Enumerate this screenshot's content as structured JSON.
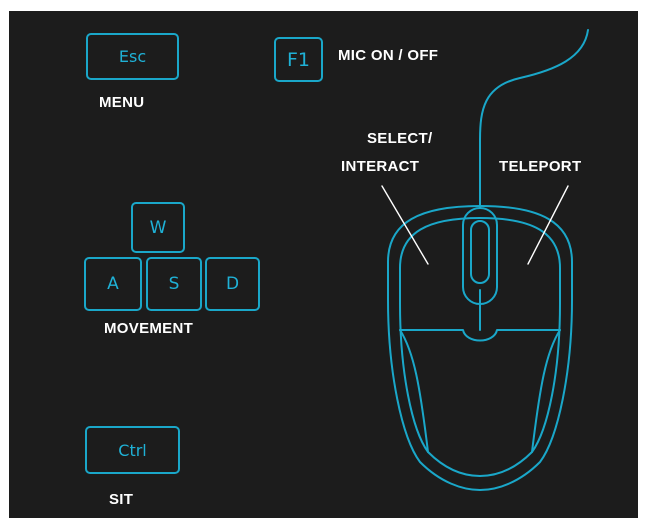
{
  "keys": {
    "esc": "Esc",
    "f1": "F1",
    "w": "W",
    "a": "A",
    "s": "S",
    "d": "D",
    "ctrl": "Ctrl"
  },
  "labels": {
    "menu": "MENU",
    "mic": "MIC ON / OFF",
    "movement": "MOVEMENT",
    "sit": "SIT",
    "select_line1": "SELECT/",
    "select_line2": "INTERACT",
    "teleport": "TELEPORT"
  },
  "colors": {
    "background": "#1c1c1c",
    "accent": "#1aa7c9",
    "text": "#ffffff"
  },
  "icons": [
    "mouse-icon"
  ]
}
